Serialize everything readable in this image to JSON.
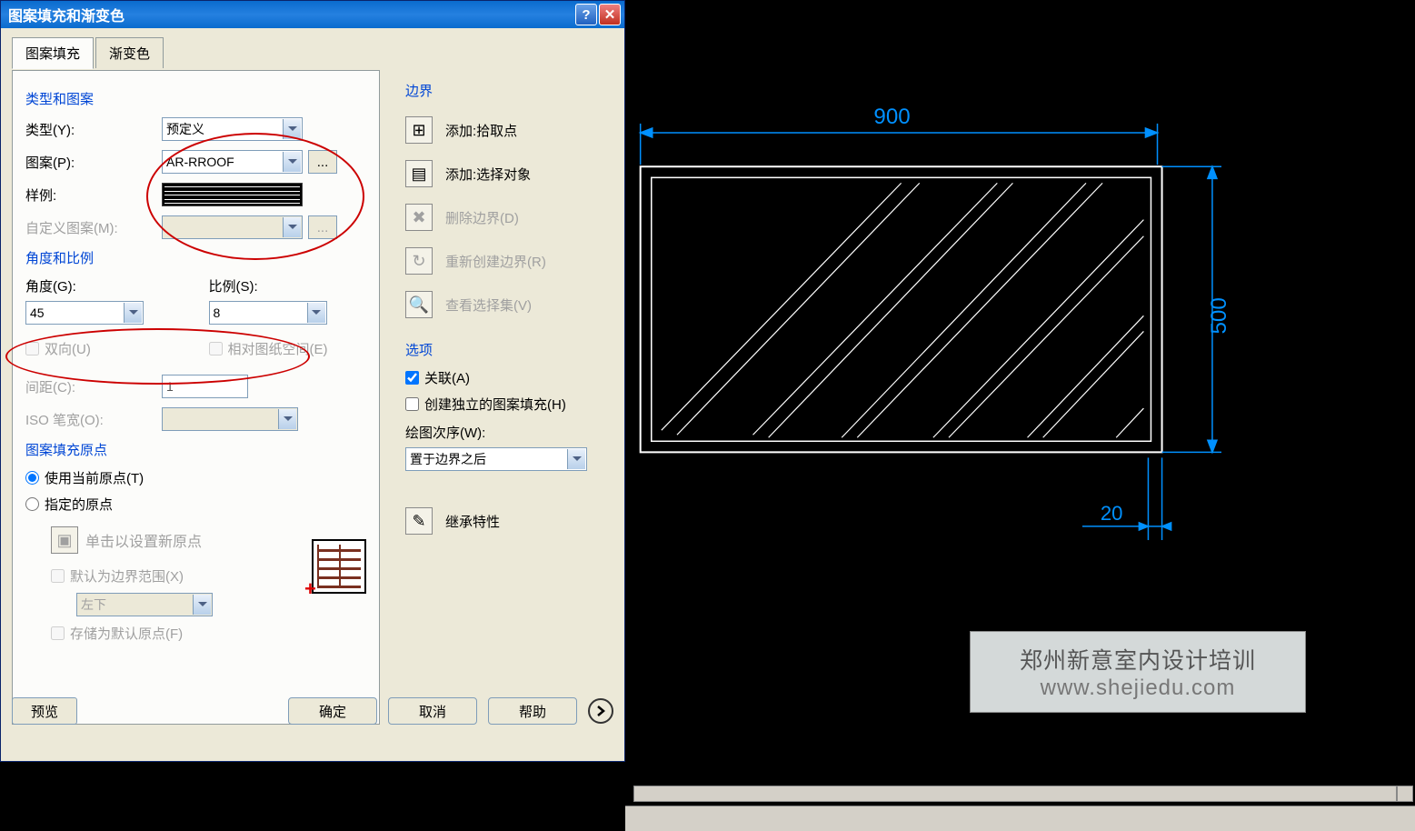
{
  "dialog": {
    "title": "图案填充和渐变色",
    "tabs": {
      "hatch": "图案填充",
      "gradient": "渐变色"
    },
    "groups": {
      "type_pattern": "类型和图案",
      "angle_scale": "角度和比例",
      "origin": "图案填充原点"
    },
    "labels": {
      "type": "类型(Y):",
      "pattern": "图案(P):",
      "sample": "样例:",
      "custom_pattern": "自定义图案(M):",
      "angle": "角度(G):",
      "scale": "比例(S):",
      "double": "双向(U)",
      "relative_paper": "相对图纸空间(E)",
      "spacing": "间距(C):",
      "iso_pen": "ISO 笔宽(O):",
      "use_current_origin": "使用当前原点(T)",
      "specify_origin": "指定的原点",
      "click_set_origin": "单击以设置新原点",
      "default_bbox": "默认为边界范围(X)",
      "store_default": "存储为默认原点(F)",
      "bbox_pos": "左下"
    },
    "values": {
      "type": "预定义",
      "pattern": "AR-RROOF",
      "angle": "45",
      "scale": "8",
      "spacing": "1"
    },
    "right": {
      "boundary": "边界",
      "add_pick": "添加:拾取点",
      "add_select": "添加:选择对象",
      "delete_boundary": "删除边界(D)",
      "recreate_boundary": "重新创建边界(R)",
      "view_selection": "查看选择集(V)",
      "options": "选项",
      "associative": "关联(A)",
      "separate": "创建独立的图案填充(H)",
      "draw_order": "绘图次序(W):",
      "draw_order_val": "置于边界之后",
      "inherit": "继承特性"
    },
    "buttons": {
      "preview": "预览",
      "ok": "确定",
      "cancel": "取消",
      "help": "帮助"
    }
  },
  "cad": {
    "dim_w": "900",
    "dim_h": "500",
    "dim_offset": "20"
  },
  "watermark": {
    "line1": "郑州新意室内设计培训",
    "line2": "www.shejiedu.com"
  }
}
